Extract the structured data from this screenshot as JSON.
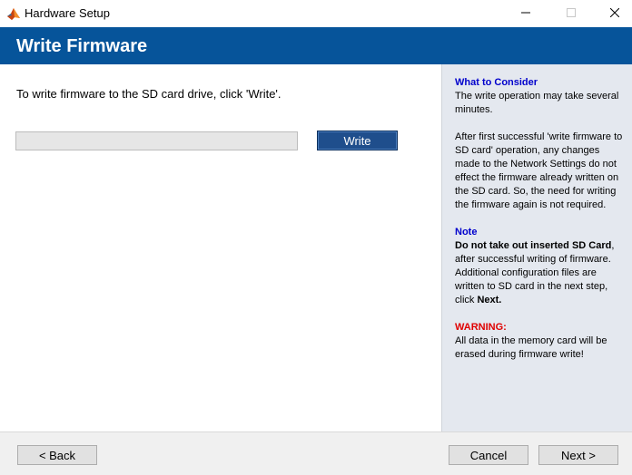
{
  "window": {
    "title": "Hardware Setup",
    "icon": "matlab-logo-icon"
  },
  "header": {
    "title": "Write Firmware",
    "background": "#06549a"
  },
  "main": {
    "instruction": "To write firmware to the SD card drive, click 'Write'.",
    "progress": 0,
    "write_label": "Write"
  },
  "side": {
    "consider_heading": "What to Consider",
    "consider_p1": "The write operation may take several minutes.",
    "consider_p2": "After first successful 'write firmware to SD card' operation, any changes made to the Network Settings do not effect the firmware already written on the SD card. So, the need for writing the firmware again is not required.",
    "note_heading": "Note",
    "note_bold": "Do not take out inserted SD Card",
    "note_text": ", after successful writing of firmware. Additional configuration files are written to SD card in the next step, click ",
    "note_next": "Next.",
    "warning_heading": "WARNING:",
    "warning_text": "All data in the memory card will be erased during firmware write!"
  },
  "footer": {
    "back_label": "< Back",
    "cancel_label": "Cancel",
    "next_label": "Next >"
  }
}
